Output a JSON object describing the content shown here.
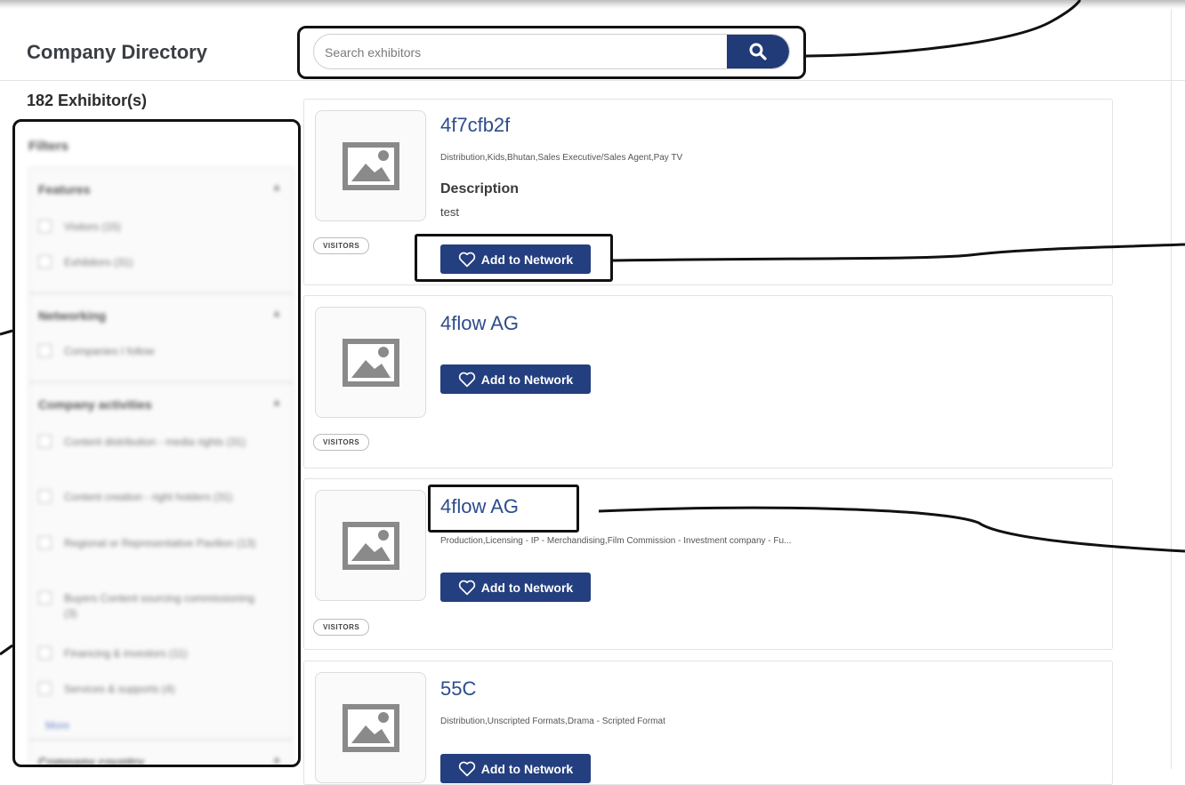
{
  "header": {
    "title": "Company Directory",
    "search_placeholder": "Search exhibitors",
    "search_icon": "search-icon"
  },
  "results": {
    "count_label": "182 Exhibitor(s)"
  },
  "filters": {
    "title": "Filters",
    "groups": [
      {
        "title": "Features",
        "options": [
          "Visitors (15)",
          "Exhibitors (31)"
        ]
      },
      {
        "title": "Networking",
        "options": [
          "Companies I follow"
        ]
      },
      {
        "title": "Company activities",
        "options": [
          "Content distribution - media rights (31)",
          "Content creation - right holders (31)",
          "Regional or Representative Pavilion (13)",
          "Buyers Content sourcing commissioning (3)",
          "Financing & investors (11)",
          "Services & supports (4)"
        ],
        "more_label": "More"
      },
      {
        "title": "Company country"
      }
    ]
  },
  "exhibitors": [
    {
      "name": "4f7cfb2f",
      "tags": "Distribution,Kids,Bhutan,Sales Executive/Sales Agent,Pay TV",
      "description_heading": "Description",
      "description": "test",
      "badge": "VISITORS",
      "button_label": "Add to Network"
    },
    {
      "name": "4flow AG",
      "badge": "VISITORS",
      "button_label": "Add to Network"
    },
    {
      "name": "4flow AG",
      "tags": "Production,Licensing - IP - Merchandising,Film Commission - Investment company - Fu...",
      "badge": "VISITORS",
      "button_label": "Add to Network"
    },
    {
      "name": "55C",
      "tags": "Distribution,Unscripted Formats,Drama - Scripted Format",
      "button_label": "Add to Network"
    }
  ],
  "colors": {
    "accent": "#243f7f",
    "link": "#2d4c8c",
    "annotation": "#111111"
  }
}
